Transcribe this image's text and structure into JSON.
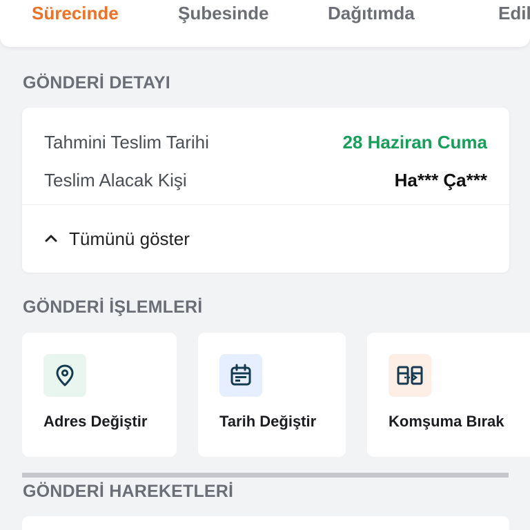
{
  "tabs": [
    {
      "label": "Sürecinde",
      "active": true
    },
    {
      "label": "Şubesinde",
      "active": false
    },
    {
      "label": "Dağıtımda",
      "active": false
    },
    {
      "label": "Edil",
      "active": false
    }
  ],
  "detail_section": {
    "title": "GÖNDERİ DETAYI",
    "rows": [
      {
        "label": "Tahmini Teslim Tarihi",
        "value": "28 Haziran Cuma"
      },
      {
        "label": "Teslim Alacak Kişi",
        "value": "Ha*** Ça***"
      }
    ],
    "toggle_label": "Tümünü göster"
  },
  "actions_section": {
    "title": "GÖNDERİ İŞLEMLERİ",
    "items": [
      {
        "label": "Adres Değiştir",
        "icon": "location-pin-icon",
        "bg": "#e8f6ef"
      },
      {
        "label": "Tarih Değiştir",
        "icon": "calendar-icon",
        "bg": "#e6efff"
      },
      {
        "label": "Komşuma Bırak",
        "icon": "neighbor-transfer-icon",
        "bg": "#fdeee6"
      }
    ]
  },
  "movements_section": {
    "title": "GÖNDERİ HAREKETLERİ"
  },
  "colors": {
    "accent": "#f36f21",
    "success": "#14a05a",
    "icon_dark": "#143a52"
  }
}
